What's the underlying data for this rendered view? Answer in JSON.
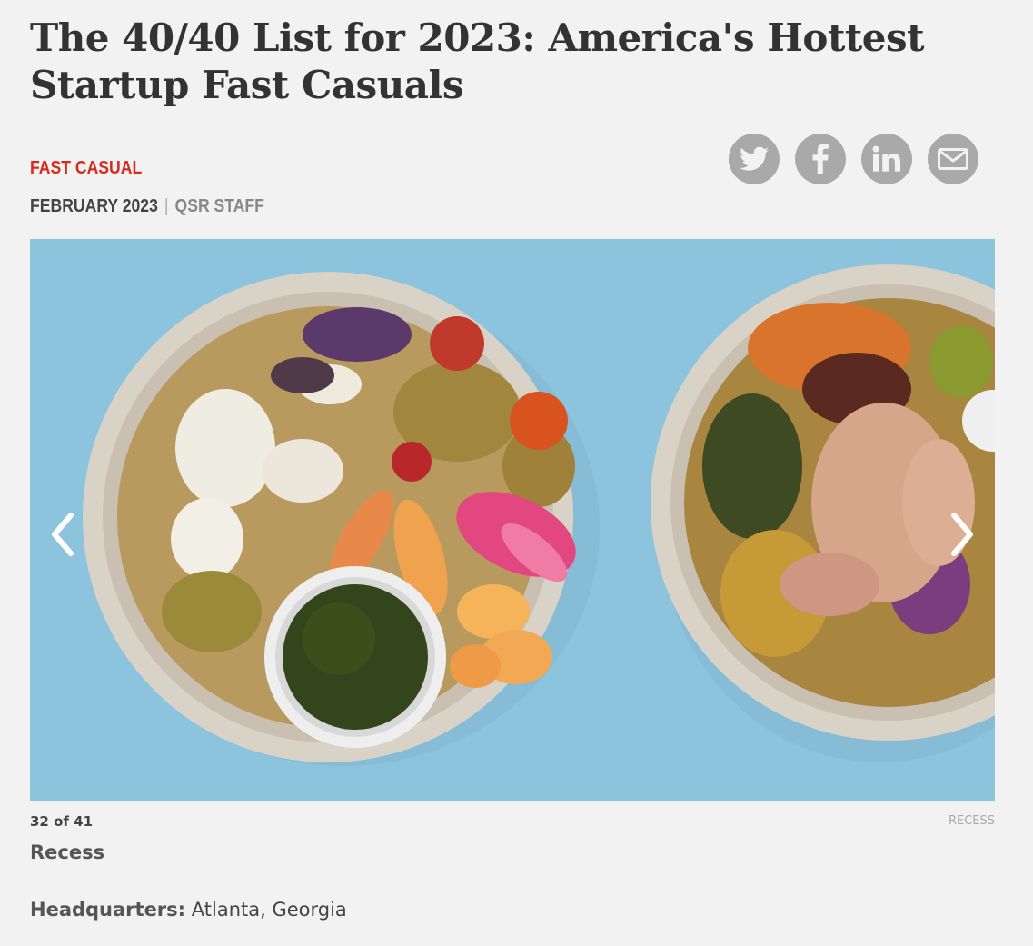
{
  "article": {
    "title": "The 40/40 List for 2023: America's Hottest Startup Fast Casuals",
    "category": "FAST CASUAL",
    "date": "FEBRUARY 2023",
    "separator": "|",
    "author": "QSR STAFF"
  },
  "share": {
    "icons": [
      "twitter-icon",
      "facebook-icon",
      "linkedin-icon",
      "email-icon"
    ],
    "icon_color": "#a9a9a9"
  },
  "slideshow": {
    "counter": "32 of 41",
    "credit": "RECESS",
    "slide_title": "Recess",
    "hq_label": "Headquarters:",
    "hq_value": "Atlanta, Georgia",
    "prev_icon": "chevron-left-icon",
    "next_icon": "chevron-right-icon"
  },
  "colors": {
    "accent": "#d62b1f",
    "background": "#f2f2f2",
    "photo_background": "#8cc3dd"
  }
}
